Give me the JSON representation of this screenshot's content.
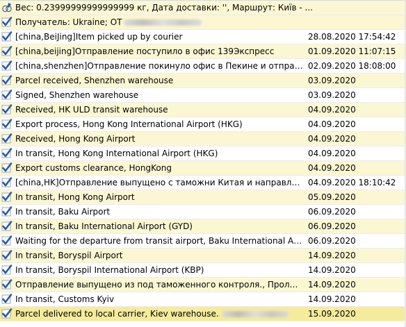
{
  "header": {
    "info_line": "Вес: 0.23999999999999999 кг,  Дата доставки: '',  Маршрут: Київ - ...",
    "recipient_line": "Получатель: Ukraine; ОТ"
  },
  "events": [
    {
      "description": "[china,BeiJing]Item picked up by courier",
      "date": "28.08.2020 17:54:42"
    },
    {
      "description": "[china,beijing]Отправление поступило в офис 139Экспресс",
      "date": "01.09.2020 11:07:15"
    },
    {
      "description": "[china,shenzhen]Отправление покинуло офис в Пекине и отправлено...",
      "date": "02.09.2020 18:08:00"
    },
    {
      "description": "Parcel received, Shenzhen warehouse",
      "date": "03.09.2020"
    },
    {
      "description": "Signed, Shenzhen warehouse",
      "date": "03.09.2020"
    },
    {
      "description": "Received, HK ULD transit warehouse",
      "date": "04.09.2020"
    },
    {
      "description": "Export process, Hong Kong International Airport (HKG)",
      "date": "04.09.2020"
    },
    {
      "description": "Received, Hong Kong Airport",
      "date": "04.09.2020"
    },
    {
      "description": "In transit, Hong Kong International Airport (HKG)",
      "date": "04.09.2020"
    },
    {
      "description": "Export customs clearance, HongKong",
      "date": "04.09.2020"
    },
    {
      "description": "[china,HK]Отправление выпущено с таможни Китая и направлено ...",
      "date": "04.09.2020 18:10:42"
    },
    {
      "description": "In transit, Hong Kong Airport",
      "date": "05.09.2020"
    },
    {
      "description": "In transit, Baku Airport",
      "date": "06.09.2020"
    },
    {
      "description": "In transit, Baku International Airport (GYD)",
      "date": "06.09.2020"
    },
    {
      "description": "Waiting for the departure from transit airport, Baku International Airp...",
      "date": "06.09.2020"
    },
    {
      "description": "In transit, Boryspil Airport",
      "date": "14.09.2020"
    },
    {
      "description": "In transit, Boryspil International Airport (KBP)",
      "date": "14.09.2020"
    },
    {
      "description": "Отправление выпущено из под таможенного контроля., Пролиски",
      "date": "14.09.2020"
    },
    {
      "description": "In transit, Customs Kyiv",
      "date": "14.09.2020"
    },
    {
      "description": "Parcel delivered to local carrier, Kiev warehouse.",
      "date": "15.09.2020"
    }
  ],
  "colors": {
    "row_alt": "#fbf7d3",
    "row_plain": "#ffffff",
    "row_last": "#f6eb9b",
    "check_blue": "#2c5aa0",
    "check_outline": "#9aa7bd"
  },
  "icons": {
    "header_info": "pin-link-icon",
    "header_recipient": "check-icon",
    "event": "check-icon"
  }
}
